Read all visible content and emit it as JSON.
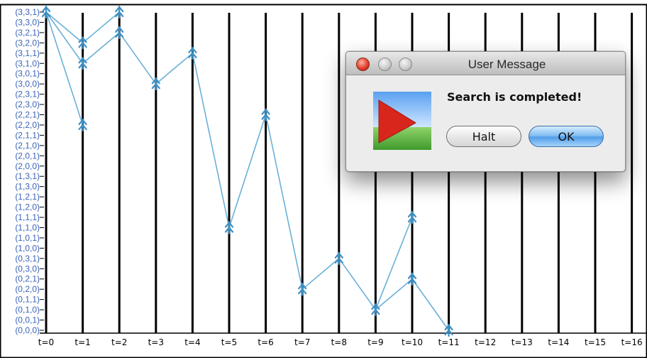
{
  "chart_data": {
    "type": "line",
    "title": "",
    "xlabel": "",
    "ylabel": "",
    "categories": [
      "t=0",
      "t=1",
      "t=2",
      "t=3",
      "t=4",
      "t=5",
      "t=6",
      "t=7",
      "t=8",
      "t=9",
      "t=10",
      "t=11",
      "t=12",
      "t=13",
      "t=14",
      "t=15",
      "t=16"
    ],
    "y_states": [
      "(0,0,0)",
      "(0,0,1)",
      "(0,1,0)",
      "(0,1,1)",
      "(0,2,0)",
      "(0,2,1)",
      "(0,3,0)",
      "(0,3,1)",
      "(1,0,0)",
      "(1,0,1)",
      "(1,1,0)",
      "(1,1,1)",
      "(1,2,0)",
      "(1,2,1)",
      "(1,3,0)",
      "(1,3,1)",
      "(2,0,0)",
      "(2,0,1)",
      "(2,1,0)",
      "(2,1,1)",
      "(2,2,0)",
      "(2,2,1)",
      "(2,3,0)",
      "(2,3,1)",
      "(3,0,0)",
      "(3,0,1)",
      "(3,1,0)",
      "(3,1,1)",
      "(3,2,0)",
      "(3,2,1)",
      "(3,3,0)",
      "(3,3,1)"
    ],
    "segments": [
      {
        "from": [
          "t=0",
          "(3,3,1)"
        ],
        "to": [
          "t=1",
          "(3,2,0)"
        ]
      },
      {
        "from": [
          "t=0",
          "(3,3,1)"
        ],
        "to": [
          "t=1",
          "(3,1,0)"
        ]
      },
      {
        "from": [
          "t=0",
          "(3,3,1)"
        ],
        "to": [
          "t=1",
          "(2,2,0)"
        ]
      },
      {
        "from": [
          "t=1",
          "(3,2,0)"
        ],
        "to": [
          "t=2",
          "(3,3,1)"
        ]
      },
      {
        "from": [
          "t=1",
          "(3,1,0)"
        ],
        "to": [
          "t=2",
          "(3,2,1)"
        ]
      },
      {
        "from": [
          "t=2",
          "(3,2,1)"
        ],
        "to": [
          "t=3",
          "(3,0,0)"
        ]
      },
      {
        "from": [
          "t=3",
          "(3,0,0)"
        ],
        "to": [
          "t=4",
          "(3,1,1)"
        ]
      },
      {
        "from": [
          "t=4",
          "(3,1,1)"
        ],
        "to": [
          "t=5",
          "(1,1,0)"
        ]
      },
      {
        "from": [
          "t=5",
          "(1,1,0)"
        ],
        "to": [
          "t=6",
          "(2,2,1)"
        ]
      },
      {
        "from": [
          "t=6",
          "(2,2,1)"
        ],
        "to": [
          "t=7",
          "(0,2,0)"
        ]
      },
      {
        "from": [
          "t=7",
          "(0,2,0)"
        ],
        "to": [
          "t=8",
          "(0,3,1)"
        ]
      },
      {
        "from": [
          "t=8",
          "(0,3,1)"
        ],
        "to": [
          "t=9",
          "(0,1,0)"
        ]
      },
      {
        "from": [
          "t=9",
          "(0,1,0)"
        ],
        "to": [
          "t=10",
          "(0,2,1)"
        ]
      },
      {
        "from": [
          "t=9",
          "(0,1,0)"
        ],
        "to": [
          "t=10",
          "(1,1,1)"
        ]
      },
      {
        "from": [
          "t=10",
          "(0,2,1)"
        ],
        "to": [
          "t=11",
          "(0,0,0)"
        ]
      }
    ],
    "points": [
      [
        "t=0",
        "(3,3,1)"
      ],
      [
        "t=1",
        "(3,2,0)"
      ],
      [
        "t=1",
        "(3,1,0)"
      ],
      [
        "t=1",
        "(2,2,0)"
      ],
      [
        "t=2",
        "(3,3,1)"
      ],
      [
        "t=2",
        "(3,2,1)"
      ],
      [
        "t=3",
        "(3,0,0)"
      ],
      [
        "t=4",
        "(3,1,1)"
      ],
      [
        "t=5",
        "(1,1,0)"
      ],
      [
        "t=6",
        "(2,2,1)"
      ],
      [
        "t=7",
        "(0,2,0)"
      ],
      [
        "t=8",
        "(0,3,1)"
      ],
      [
        "t=9",
        "(0,1,0)"
      ],
      [
        "t=10",
        "(0,2,1)"
      ],
      [
        "t=10",
        "(1,1,1)"
      ],
      [
        "t=11",
        "(0,0,0)"
      ]
    ],
    "grid": true,
    "colors": {
      "line": "#6ab0d8",
      "marker": "#3d8fc4",
      "tick_label": "#3a63b8",
      "gridline": "#000000"
    }
  },
  "dialog": {
    "title": "User Message",
    "message": "Search is completed!",
    "halt_label": "Halt",
    "ok_label": "OK",
    "icon": "red-arrow-landscape-icon"
  }
}
